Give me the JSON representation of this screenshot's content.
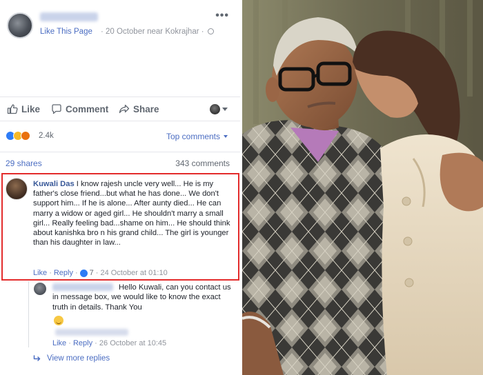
{
  "post": {
    "like_page": "Like This Page",
    "meta": "· 20 October near Kokrajhar ·",
    "more": "•••"
  },
  "actions": {
    "like": "Like",
    "comment": "Comment",
    "share": "Share"
  },
  "reactions": {
    "count": "2.4k",
    "sort_label": "Top comments"
  },
  "counts": {
    "shares": "29 shares",
    "comments": "343 comments"
  },
  "comment": {
    "author": "Kuwali Das",
    "text": " I know rajesh uncle very well... He is my father's close friend...but what he has done... We don't support him... If he is alone... After aunty died... He can marry a widow or aged girl... He shouldn't marry a small girl... Really feeling bad...shame on him... He should think about kanishka bro n his grand child... The girl is younger than his daughter in law...",
    "like": "Like",
    "reply": "Reply",
    "like_count": "7",
    "time": "24 October at 01:10"
  },
  "reply": {
    "text": "Hello Kuwali, can you contact us in message box, we would like to know the exact truth in details. Thank You",
    "like": "Like",
    "reply": "Reply",
    "time": "26 October at 10:45"
  },
  "view_more": "View more replies",
  "colors": {
    "link_blue": "#4b6dc2",
    "highlight_red": "#e32b2b",
    "like_blue": "#2e7cf6"
  }
}
